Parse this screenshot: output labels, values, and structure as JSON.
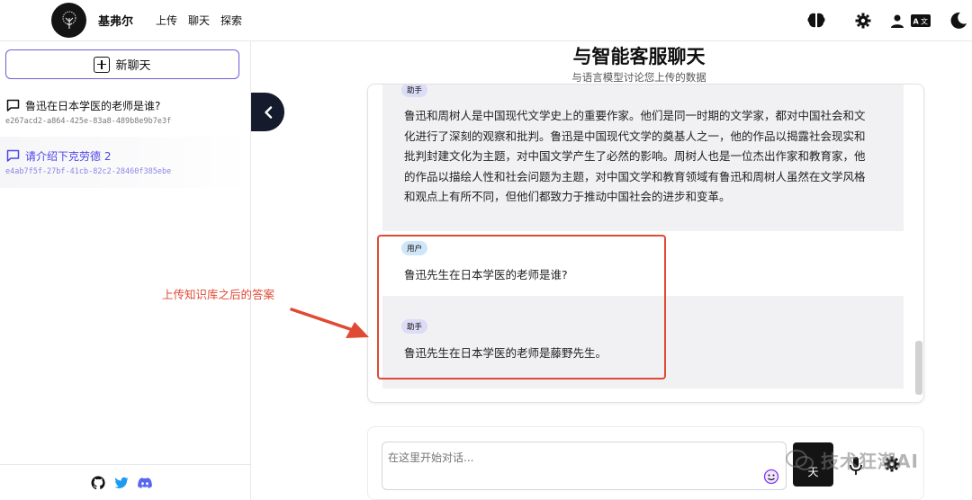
{
  "header": {
    "brand": "基弗尔",
    "nav": [
      "上传",
      "聊天",
      "探索"
    ],
    "icons": [
      "brain-icon",
      "gear-icon",
      "user-icon",
      "translate-icon",
      "moon-icon"
    ]
  },
  "sidebar": {
    "new_chat_label": "新聊天",
    "conversations": [
      {
        "title": "鲁迅在日本学医的老师是谁?",
        "id": "e267acd2-a864-425e-83a8-489b8e9b7e3f"
      },
      {
        "title": "请介绍下克劳德 2",
        "id": "e4ab7f5f-27bf-41cb-82c2-28460f385ebe"
      }
    ],
    "footer_icons": [
      "github-icon",
      "twitter-icon",
      "discord-icon"
    ]
  },
  "main": {
    "title": "与智能客服聊天",
    "subtitle": "与语言模型讨论您上传的数据",
    "messages": [
      {
        "role": "assistant",
        "role_label": "助手",
        "text": "鲁迅和周树人是中国现代文学史上的重要作家。他们是同一时期的文学家，都对中国社会和文化进行了深刻的观察和批判。鲁迅是中国现代文学的奠基人之一，他的作品以揭露社会现实和批判封建文化为主题，对中国文学产生了必然的影响。周树人也是一位杰出作家和教育家，他的作品以描绘人性和社会问题为主题，对中国文学和教育领域有鲁迅和周树人虽然在文学风格和观点上有所不同，但他们都致力于推动中国社会的进步和变革。"
      },
      {
        "role": "user",
        "role_label": "用户",
        "text": "鲁迅先生在日本学医的老师是谁?"
      },
      {
        "role": "assistant",
        "role_label": "助手",
        "text": "鲁迅先生在日本学医的老师是藤野先生。"
      }
    ],
    "annotation": "上传知识库之后的答案",
    "input": {
      "placeholder": "在这里开始对话...",
      "send_label": "天"
    },
    "watermark": "技术狂潮AI"
  },
  "colors": {
    "accent": "#4f46e5",
    "annotation": "#e04a35",
    "dark": "#141414"
  }
}
